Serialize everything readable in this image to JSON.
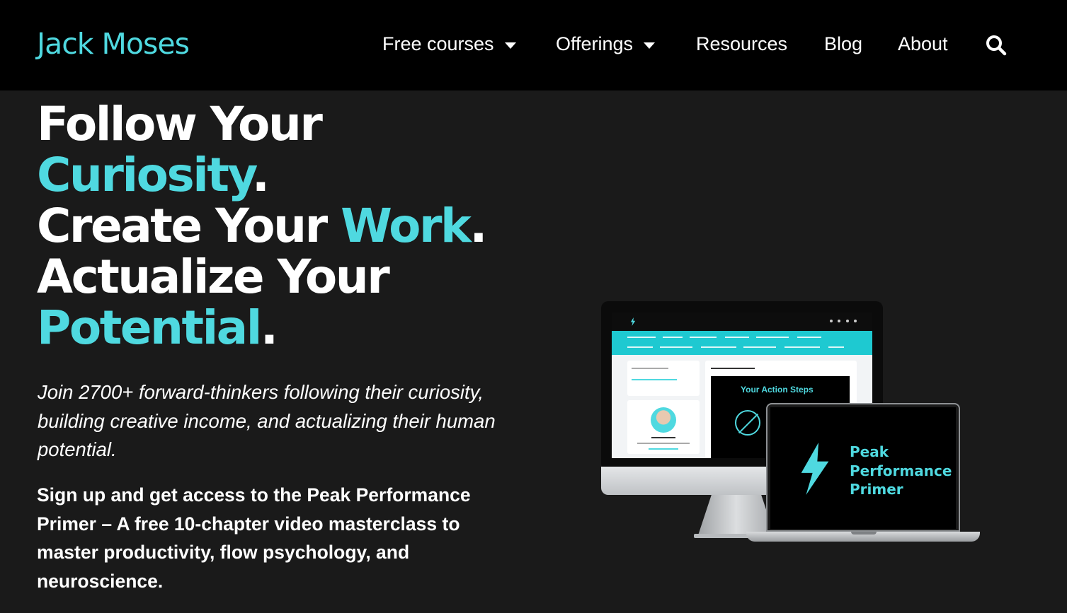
{
  "header": {
    "logo": "Jack Moses",
    "nav": [
      {
        "label": "Free courses",
        "dropdown": true
      },
      {
        "label": "Offerings",
        "dropdown": true
      },
      {
        "label": "Resources",
        "dropdown": false
      },
      {
        "label": "Blog",
        "dropdown": false
      },
      {
        "label": "About",
        "dropdown": false
      }
    ],
    "search_icon": "search-icon"
  },
  "hero": {
    "line1": "Follow Your",
    "line2_accent": "Curiosity",
    "line2_dot": ".",
    "line3_a": "Create Your ",
    "line3_accent": "Work",
    "line3_dot": ".",
    "line4": "Actualize Your",
    "line5_accent": "Potential",
    "line5_dot": "."
  },
  "lead": "Join 2700+ forward-thinkers following their curiosity, building creative income, and actualizing their human potential.",
  "signup": "Sign up and get access to the Peak Performance Primer – A free 10-chapter video masterclass to master productivity, flow psychology, and neuroscience.",
  "mockup": {
    "video_title": "Your Action Steps",
    "laptop_title": "Peak Performance Primer"
  },
  "colors": {
    "accent": "#4fd9e0",
    "header_bg": "#000000",
    "page_bg": "#1a1a1a"
  }
}
